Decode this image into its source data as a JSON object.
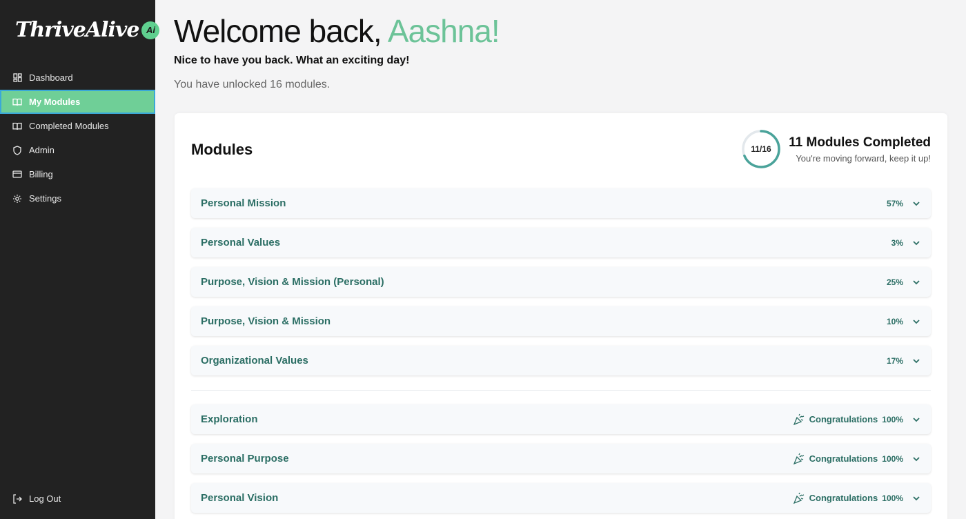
{
  "brand": {
    "logo_text": "ThriveAlive",
    "logo_badge": "Ai"
  },
  "sidebar": {
    "items": [
      {
        "label": "Dashboard",
        "icon": "dashboard-icon"
      },
      {
        "label": "My Modules",
        "icon": "book-icon",
        "active": true
      },
      {
        "label": "Completed Modules",
        "icon": "book-icon"
      },
      {
        "label": "Admin",
        "icon": "shield-icon"
      },
      {
        "label": "Billing",
        "icon": "card-icon"
      },
      {
        "label": "Settings",
        "icon": "gear-icon"
      }
    ],
    "logout_label": "Log Out"
  },
  "header": {
    "welcome_prefix": "Welcome back, ",
    "user_name": "Aashna!",
    "subtitle": "Nice to have you back. What an exciting day!",
    "unlocked": "You have unlocked 16 modules."
  },
  "modules_card": {
    "title": "Modules",
    "progress_label": "11/16",
    "progress_fraction": 0.6875,
    "completed_title": "11 Modules Completed",
    "completed_sub": "You're moving forward, keep it up!",
    "in_progress": [
      {
        "name": "Personal Mission",
        "percent": "57%"
      },
      {
        "name": "Personal Values",
        "percent": "3%"
      },
      {
        "name": "Purpose, Vision & Mission (Personal)",
        "percent": "25%"
      },
      {
        "name": "Purpose, Vision & Mission",
        "percent": "10%"
      },
      {
        "name": "Organizational Values",
        "percent": "17%"
      }
    ],
    "completed": [
      {
        "name": "Exploration",
        "congrats": "Congratulations",
        "percent": "100%"
      },
      {
        "name": "Personal Purpose",
        "congrats": "Congratulations",
        "percent": "100%"
      },
      {
        "name": "Personal Vision",
        "congrats": "Congratulations",
        "percent": "100%"
      }
    ]
  },
  "colors": {
    "accent": "#6cc398",
    "sidebar_bg": "#222222",
    "module_text": "#2b6e64",
    "ring": "#4aa39a"
  }
}
